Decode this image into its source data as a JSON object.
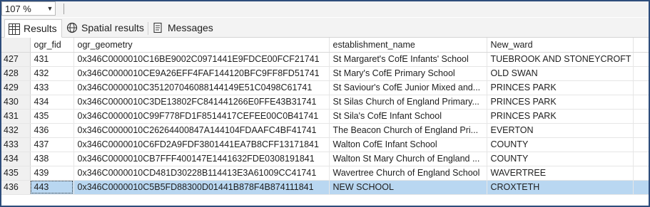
{
  "zoom": {
    "value": "107 %"
  },
  "tabs": [
    {
      "label": "Results",
      "icon": "grid-icon",
      "active": true
    },
    {
      "label": "Spatial results",
      "icon": "globe-icon",
      "active": false
    },
    {
      "label": "Messages",
      "icon": "messages-icon",
      "active": false
    }
  ],
  "grid": {
    "columns": [
      "ogr_fid",
      "ogr_geometry",
      "establishment_name",
      "New_ward"
    ],
    "rows": [
      {
        "n": "427",
        "fid": "431",
        "geom": "0x346C0000010C16BE9002C0971441E9FDCE00FCF21741",
        "name": "St Margaret's CofE Infants' School",
        "ward": "TUEBROOK AND STONEYCROFT"
      },
      {
        "n": "428",
        "fid": "432",
        "geom": "0x346C0000010CE9A26EFF4FAF144120BFC9FF8FD51741",
        "name": "St Mary's CofE Primary School",
        "ward": "OLD SWAN"
      },
      {
        "n": "429",
        "fid": "433",
        "geom": "0x346C0000010C351207046088144149E51C0498C61741",
        "name": "St Saviour's CofE Junior Mixed and...",
        "ward": "PRINCES PARK"
      },
      {
        "n": "430",
        "fid": "434",
        "geom": "0x346C0000010C3DE13802FC841441266E0FFE43B31741",
        "name": "St Silas Church of England Primary...",
        "ward": "PRINCES PARK"
      },
      {
        "n": "431",
        "fid": "435",
        "geom": "0x346C0000010C99F778FD1F8514417CEFEE00C0B41741",
        "name": "St Sila's CofE Infant School",
        "ward": "PRINCES PARK"
      },
      {
        "n": "432",
        "fid": "436",
        "geom": "0x346C0000010C26264400847A144104FDAAFC4BF41741",
        "name": "The Beacon Church of England Pri...",
        "ward": "EVERTON"
      },
      {
        "n": "433",
        "fid": "437",
        "geom": "0x346C0000010C6FD2A9FDF3801441EA7B8CFF13171841",
        "name": "Walton CofE Infant School",
        "ward": "COUNTY"
      },
      {
        "n": "434",
        "fid": "438",
        "geom": "0x346C0000010CB7FFF400147E1441632FDE0308191841",
        "name": "Walton St Mary Church of England ...",
        "ward": "COUNTY"
      },
      {
        "n": "435",
        "fid": "439",
        "geom": "0x346C0000010CD481D30228B114413E3A61009CC41741",
        "name": "Wavertree Church of England School",
        "ward": "WAVERTREE"
      },
      {
        "n": "436",
        "fid": "443",
        "geom": "0x346C0000010C5B5FD88300D01441B878F4B874111841",
        "name": "NEW SCHOOL",
        "ward": "CROXTETH",
        "selected": true
      }
    ]
  }
}
